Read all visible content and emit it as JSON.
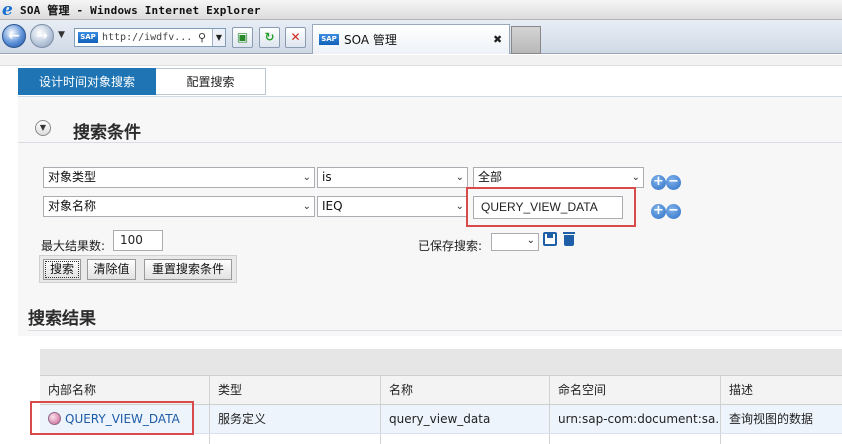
{
  "window": {
    "title": "SOA 管理 - Windows Internet Explorer"
  },
  "browser": {
    "address": "http://iwdfv...",
    "tab_label": "SOA 管理",
    "sap_badge": "SAP",
    "icons": {
      "back": "back-arrow-icon",
      "forward": "forward-arrow-icon",
      "compat": "compatibility-view-icon",
      "refresh": "refresh-icon",
      "stop": "stop-icon",
      "close": "close-icon"
    }
  },
  "page_tabs": [
    {
      "label": "设计时间对象搜索",
      "active": true
    },
    {
      "label": "配置搜索",
      "active": false
    }
  ],
  "search": {
    "section_title": "搜索条件",
    "criteria": [
      {
        "field": "对象类型",
        "operator": "is",
        "value": "全部",
        "value_is_select": true
      },
      {
        "field": "对象名称",
        "operator": "IEQ",
        "value": "QUERY_VIEW_DATA",
        "value_is_select": false
      }
    ],
    "max_results_label": "最大结果数:",
    "max_results_value": "100",
    "saved_search_label": "已保存搜索:",
    "saved_search_value": "",
    "buttons": {
      "search": "搜索",
      "clear": "清除值",
      "reset": "重置搜索条件"
    }
  },
  "results": {
    "section_title": "搜索结果",
    "columns": [
      "内部名称",
      "类型",
      "名称",
      "命名空间",
      "描述"
    ],
    "rows": [
      {
        "internal_name": "QUERY_VIEW_DATA",
        "type": "服务定义",
        "name": "query_view_data",
        "namespace": "urn:sap-com:document:sa...",
        "description": "查询视图的数据"
      }
    ]
  },
  "colors": {
    "accent": "#1f74b4",
    "highlight": "#d94b4b",
    "link": "#1c5ca8"
  }
}
